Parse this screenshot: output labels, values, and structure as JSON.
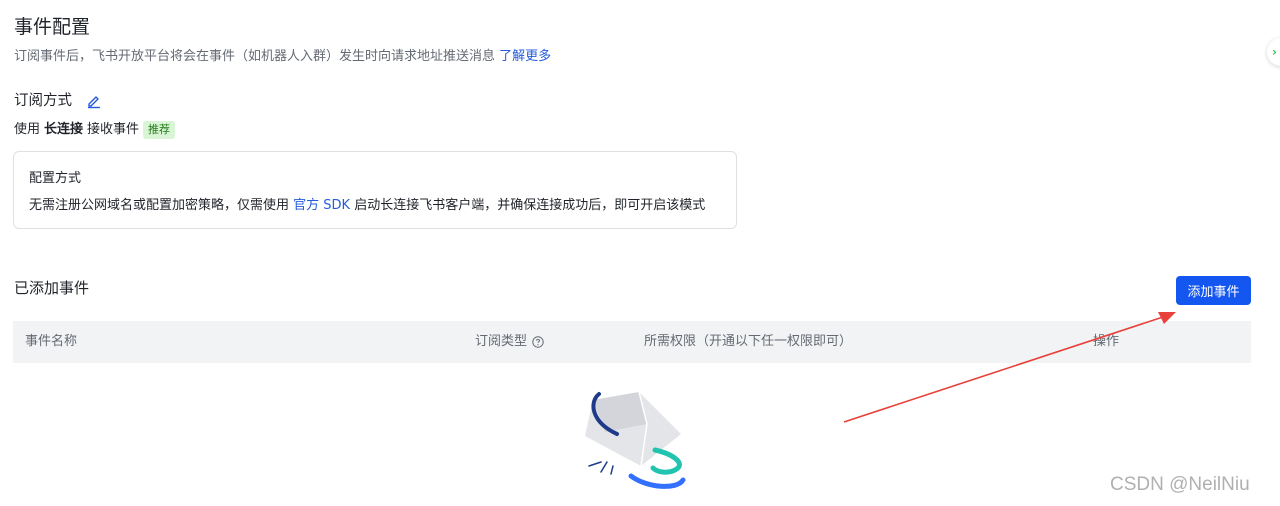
{
  "page": {
    "title": "事件配置",
    "description": "订阅事件后，飞书开放平台将会在事件（如机器人入群）发生时向请求地址推送消息",
    "learn_more": "了解更多"
  },
  "subscription": {
    "title": "订阅方式",
    "use_prefix": "使用",
    "method": "长连接",
    "use_suffix": "接收事件",
    "badge": "推荐"
  },
  "config_card": {
    "title": "配置方式",
    "desc_prefix": "无需注册公网域名或配置加密策略，仅需使用",
    "sdk_link": "官方 SDK",
    "desc_suffix": "启动长连接飞书客户端，并确保连接成功后，即可开启该模式"
  },
  "events": {
    "title": "已添加事件",
    "add_button": "添加事件",
    "columns": [
      "事件名称",
      "订阅类型",
      "所需权限（开通以下任一权限即可）",
      "操作"
    ],
    "rows": []
  },
  "icons": {
    "edit": "edit-pencil-icon",
    "help": "question-circle-icon",
    "empty": "empty-box-illustration"
  },
  "colors": {
    "primary": "#1456f0",
    "link": "#245bdb",
    "badge_bg": "#d9f5d6",
    "badge_text": "#237b19",
    "annotation_arrow": "#e8413b"
  },
  "watermark": "CSDN @NeilNiu"
}
